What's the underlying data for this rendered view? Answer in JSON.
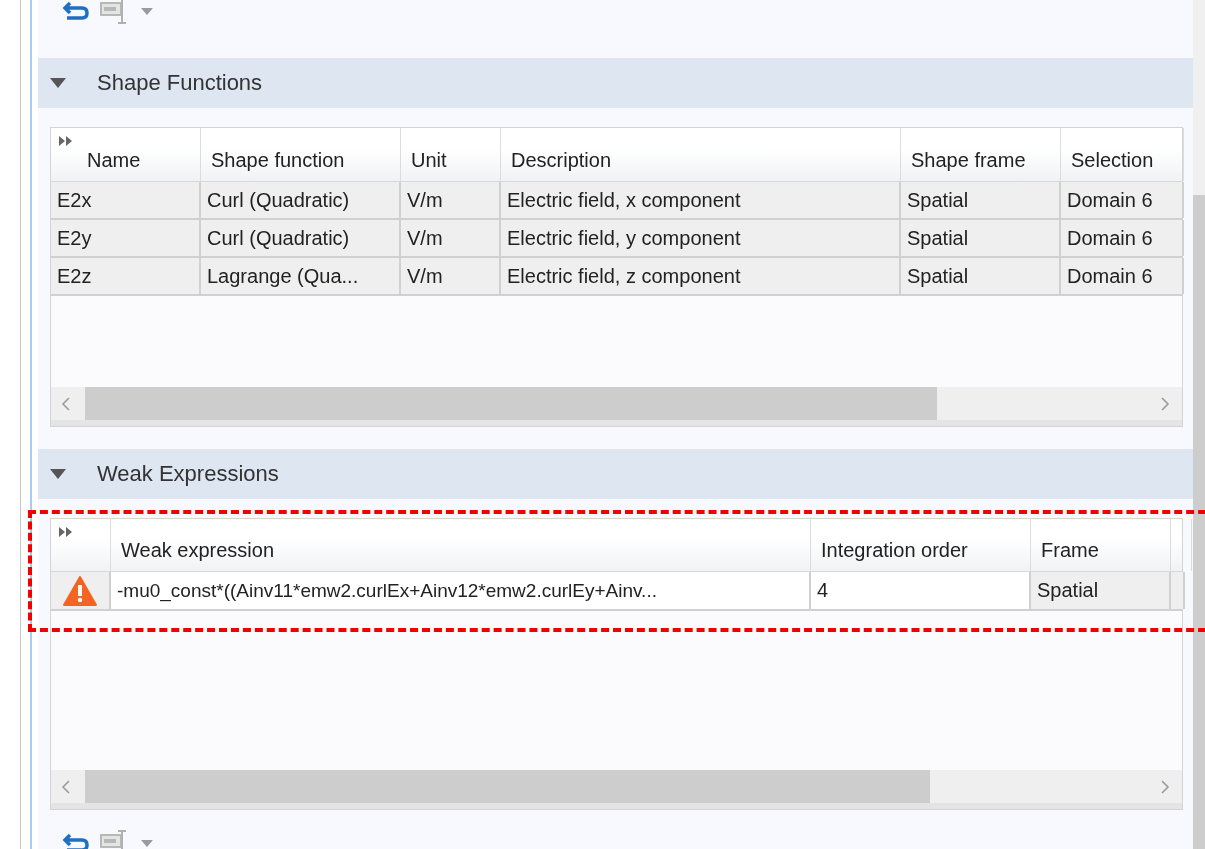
{
  "sections": [
    {
      "title": "Shape Functions",
      "expanded": true,
      "table": {
        "columns": [
          {
            "label": "Name",
            "editable": false
          },
          {
            "label": "Shape function",
            "editable": false
          },
          {
            "label": "Unit",
            "editable": false
          },
          {
            "label": "Description",
            "editable": false
          },
          {
            "label": "Shape frame",
            "editable": false
          },
          {
            "label": "Selection",
            "editable": false
          }
        ],
        "rows": [
          {
            "cells": [
              "E2x",
              "Curl (Quadratic)",
              "V/m",
              "Electric field, x component",
              "Spatial",
              "Domain 6"
            ]
          },
          {
            "cells": [
              "E2y",
              "Curl (Quadratic)",
              "V/m",
              "Electric field, y component",
              "Spatial",
              "Domain 6"
            ]
          },
          {
            "cells": [
              "E2z",
              "Lagrange (Qua...",
              "V/m",
              "Electric field, z component",
              "Spatial",
              "Domain 6"
            ]
          }
        ]
      }
    },
    {
      "title": "Weak Expressions",
      "expanded": true,
      "table": {
        "columns": [
          {
            "label": "Weak expression",
            "editable": true
          },
          {
            "label": "Integration order",
            "editable": true
          },
          {
            "label": "Frame",
            "editable": false
          }
        ],
        "rows": [
          {
            "warning": true,
            "cells": [
              "-mu0_const*((Ainv11*emw2.curlEx+Ainv12*emw2.curlEy+Ainv...",
              "4",
              "Spatial"
            ]
          }
        ]
      }
    }
  ]
}
